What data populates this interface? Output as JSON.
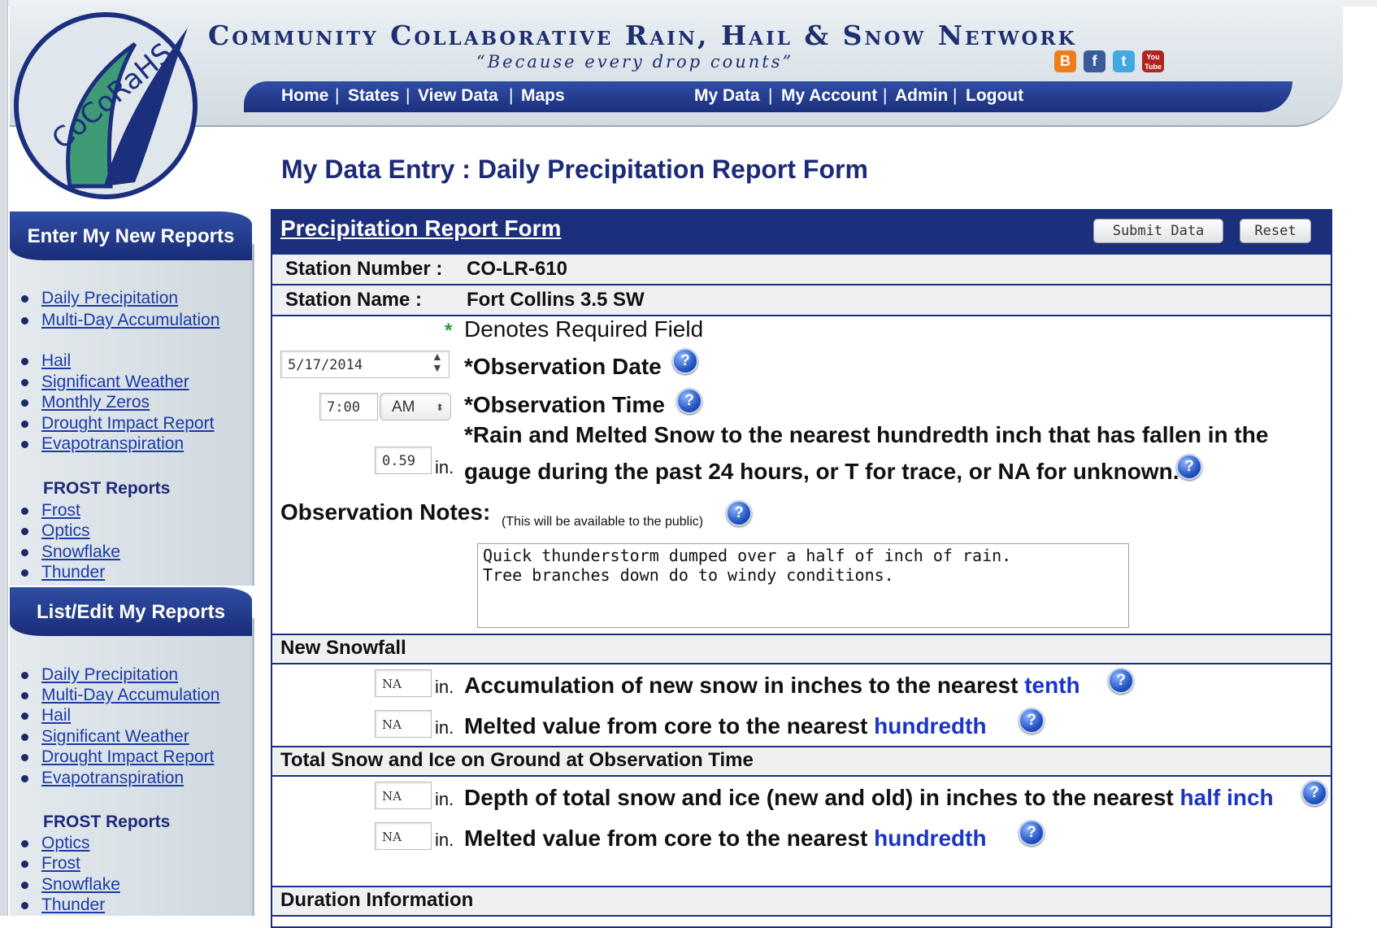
{
  "header": {
    "site_title": "Community Collaborative Rain, Hail & Snow Network",
    "tagline": "“Because every drop counts”",
    "logo_text": "CoCoRaHS",
    "nav_left": [
      "Home",
      "States",
      "View Data",
      "Maps"
    ],
    "nav_right": [
      "My Data",
      "My Account",
      "Admin",
      "Logout"
    ],
    "social": {
      "blogger": "B",
      "facebook": "f",
      "twitter": "t",
      "youtube": "You Tube"
    }
  },
  "page_heading": "My Data Entry : Daily Precipitation Report Form",
  "sidebar": {
    "new_reports_title": "Enter My New Reports",
    "new_reports": [
      "Daily Precipitation",
      "Multi-Day Accumulation",
      "Hail",
      "Significant Weather",
      "Monthly Zeros",
      "Drought Impact Report",
      "Evapotranspiration"
    ],
    "new_frost_title": "FROST Reports",
    "new_frost": [
      "Frost",
      "Optics",
      "Snowflake",
      "Thunder"
    ],
    "edit_reports_title": "List/Edit My Reports",
    "edit_reports": [
      "Daily Precipitation",
      "Multi-Day Accumulation",
      "Hail",
      "Significant Weather",
      "Drought Impact Report",
      "Evapotranspiration"
    ],
    "edit_frost_title": "FROST Reports",
    "edit_frost": [
      "Optics",
      "Frost",
      "Snowflake",
      "Thunder"
    ]
  },
  "form": {
    "title": "Precipitation Report Form",
    "submit_label": "Submit Data",
    "reset_label": "Reset",
    "station_number_label": "Station Number :",
    "station_number": "CO-LR-610",
    "station_name_label": "Station Name :",
    "station_name": "Fort Collins 3.5 SW",
    "required_star": "*",
    "required_note": "Denotes Required Field",
    "obs_date_value": "5/17/2014",
    "obs_date_label": "*Observation Date",
    "obs_time_value": "7:00",
    "obs_ampm": "AM",
    "obs_time_label": "*Observation Time",
    "rain_value": "0.59",
    "unit": "in.",
    "rain_label_1": "*Rain and Melted Snow to the nearest hundredth inch that has fallen in the",
    "rain_label_2": "gauge during the past 24 hours, or T for trace, or NA for unknown.",
    "notes_label": "Observation Notes:",
    "notes_sub": "(This will be available to the public)",
    "notes_text": "Quick thunderstorm dumped over a half of inch of rain.\nTree branches down do to windy conditions.",
    "new_snow_head": "New Snowfall",
    "snow_accum_value": "NA",
    "snow_accum_label": "Accumulation of new snow in inches to the nearest ",
    "snow_accum_em": "tenth",
    "snow_melt_value": "NA",
    "snow_melt_label": "Melted value from core to the nearest ",
    "snow_melt_em": "hundredth",
    "total_snow_head": "Total Snow and Ice on Ground at Observation Time",
    "depth_value": "NA",
    "depth_label": "Depth of total snow and ice (new and old) in inches to the nearest ",
    "depth_em": "half inch",
    "total_melt_value": "NA",
    "total_melt_label": "Melted value from core to the nearest ",
    "total_melt_em": "hundredth",
    "duration_head": "Duration Information",
    "help_glyph": "?"
  },
  "colors": {
    "navy": "#1c2f7c",
    "link": "#1a3aa8",
    "emphasis": "#1a35c8"
  }
}
